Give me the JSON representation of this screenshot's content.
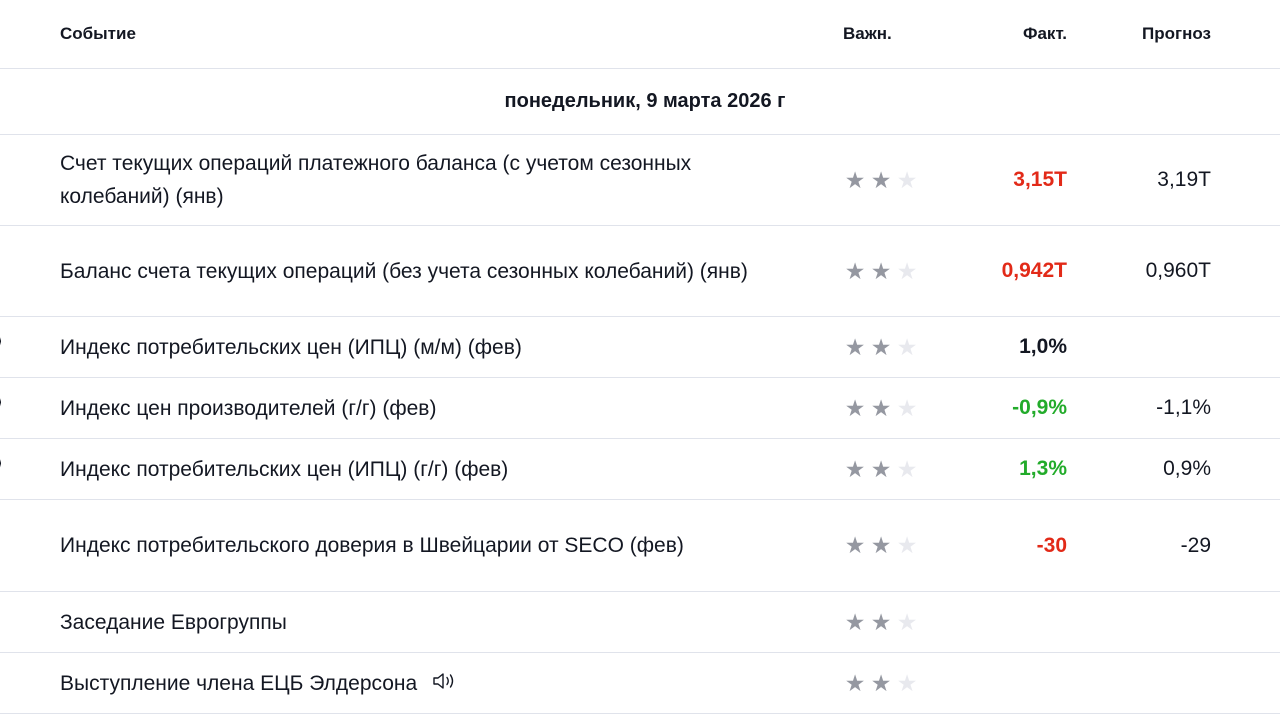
{
  "header": {
    "event": "Событие",
    "importance": "Важн.",
    "actual": "Факт.",
    "forecast": "Прогноз"
  },
  "date_label": "понедельник, 9 марта 2026 г",
  "colors": {
    "negative": "#e22a18",
    "positive": "#22ab2a",
    "neutral": "#131722",
    "star_on": "#9598a1",
    "star_off": "#e8e9ee"
  },
  "rows": [
    {
      "event": "Счет текущих операций платежного баланса (с учетом сезонных колебаний) (янв)",
      "stars": 2,
      "actual": "3,15T",
      "actual_status": "negative",
      "forecast": "3,19T"
    },
    {
      "event": "Баланс счета текущих операций (без учета сезонных колебаний) (янв)",
      "stars": 2,
      "actual": "0,942T",
      "actual_status": "negative",
      "forecast": "0,960T"
    },
    {
      "event": "Индекс потребительских цен (ИПЦ) (м/м) (фев)",
      "stars": 2,
      "actual": "1,0%",
      "actual_status": "neutral",
      "forecast": ""
    },
    {
      "event": "Индекс цен производителей (г/г) (фев)",
      "stars": 2,
      "actual": "-0,9%",
      "actual_status": "positive",
      "forecast": "-1,1%"
    },
    {
      "event": "Индекс потребительских цен (ИПЦ) (г/г) (фев)",
      "stars": 2,
      "actual": "1,3%",
      "actual_status": "positive",
      "forecast": "0,9%"
    },
    {
      "event": "Индекс потребительского доверия в Швейцарии от SECO (фев)",
      "stars": 2,
      "actual": "-30",
      "actual_status": "negative",
      "forecast": "-29"
    },
    {
      "event": "Заседание Еврогруппы",
      "stars": 2,
      "actual": "",
      "actual_status": "neutral",
      "forecast": ""
    },
    {
      "event": "Выступление члена ЕЦБ Элдерсона",
      "stars": 2,
      "actual": "",
      "actual_status": "neutral",
      "forecast": "",
      "icon": "speaker-icon"
    }
  ]
}
